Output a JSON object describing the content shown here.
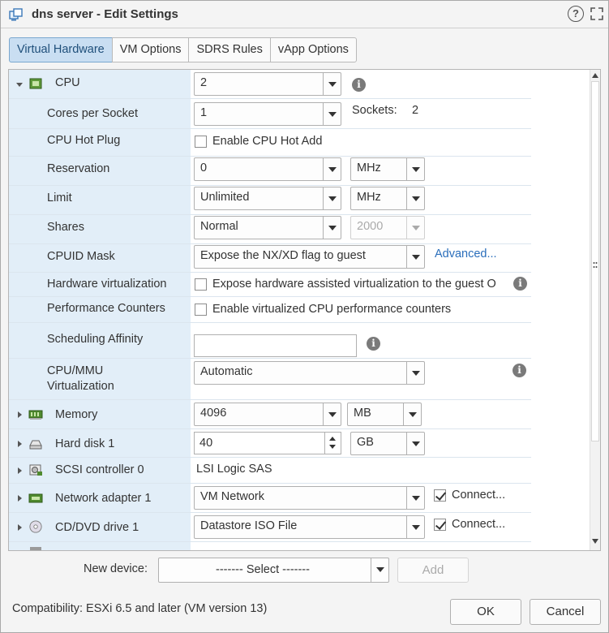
{
  "window": {
    "title": "dns server - Edit Settings",
    "help_glyph": "?"
  },
  "tabs": [
    {
      "label": "Virtual Hardware",
      "active": true
    },
    {
      "label": "VM Options",
      "active": false
    },
    {
      "label": "SDRS Rules",
      "active": false
    },
    {
      "label": "vApp Options",
      "active": false
    }
  ],
  "cpu": {
    "label": "CPU",
    "value": "2",
    "cores_per_socket": {
      "label": "Cores per Socket",
      "value": "1",
      "sockets_label": "Sockets:",
      "sockets_value": "2"
    },
    "hot_plug": {
      "label": "CPU Hot Plug",
      "checkbox_label": "Enable CPU Hot Add",
      "checked": false
    },
    "reservation": {
      "label": "Reservation",
      "value": "0",
      "unit": "MHz"
    },
    "limit": {
      "label": "Limit",
      "value": "Unlimited",
      "unit": "MHz"
    },
    "shares": {
      "label": "Shares",
      "value": "Normal",
      "amount": "2000"
    },
    "cpuid_mask": {
      "label": "CPUID Mask",
      "value": "Expose the NX/XD flag to guest",
      "advanced_link": "Advanced..."
    },
    "hw_virt": {
      "label": "Hardware virtualization",
      "checkbox_label": "Expose hardware assisted virtualization to the guest O",
      "checked": false
    },
    "perf_counters": {
      "label": "Performance Counters",
      "checkbox_label": "Enable virtualized CPU performance counters",
      "checked": false
    },
    "sched_affinity": {
      "label": "Scheduling Affinity",
      "value": ""
    },
    "mmu_virt": {
      "label_line1": "CPU/MMU",
      "label_line2": "Virtualization",
      "value": "Automatic"
    }
  },
  "memory": {
    "label": "Memory",
    "value": "4096",
    "unit": "MB"
  },
  "hard_disk": {
    "label": "Hard disk 1",
    "value": "40",
    "unit": "GB"
  },
  "scsi": {
    "label": "SCSI controller 0",
    "value": "LSI Logic SAS"
  },
  "network": {
    "label": "Network adapter 1",
    "value": "VM Network",
    "connect_label": "Connect...",
    "connected": true
  },
  "cdrom": {
    "label": "CD/DVD drive 1",
    "value": "Datastore ISO File",
    "connect_label": "Connect...",
    "connected": true
  },
  "new_device": {
    "label": "New device:",
    "select_value": "------- Select -------",
    "add_label": "Add"
  },
  "footer": {
    "compatibility": "Compatibility: ESXi 6.5 and later (VM version 13)",
    "ok_label": "OK",
    "cancel_label": "Cancel"
  },
  "colors": {
    "label_column": "#e2eef8",
    "active_tab": "#c9def2",
    "link": "#2a6ebb"
  }
}
